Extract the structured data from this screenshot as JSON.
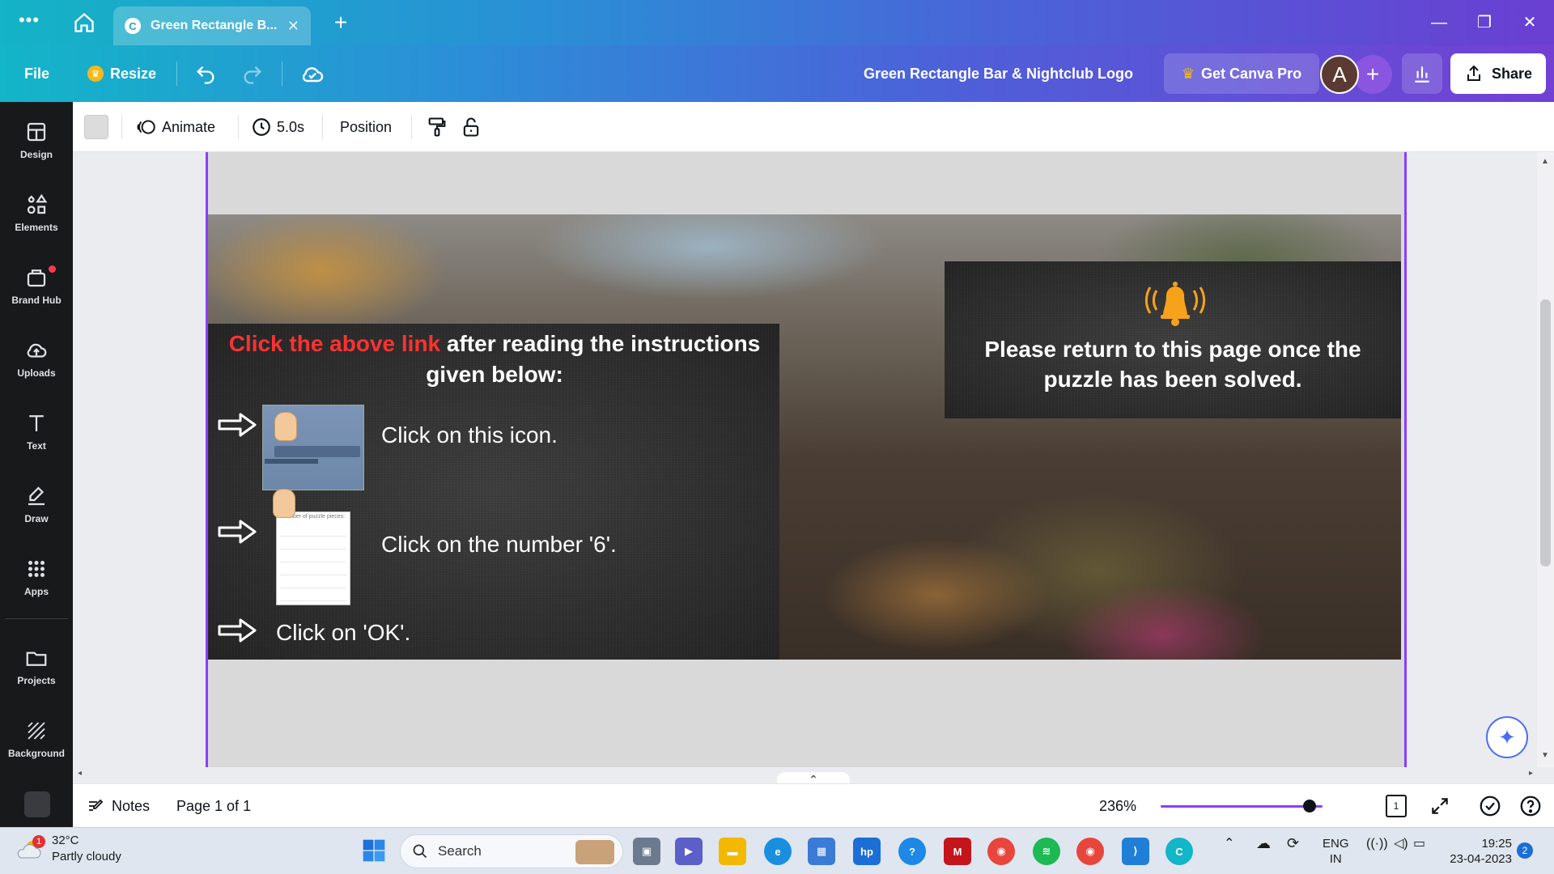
{
  "browser": {
    "tab_title": "Green Rectangle B...",
    "menu_icon": "more-dots-icon",
    "home_icon": "home-icon",
    "new_tab_icon": "plus-icon",
    "window_controls": [
      "minimize-icon",
      "restore-icon",
      "close-icon"
    ]
  },
  "header": {
    "file_label": "File",
    "resize_label": "Resize",
    "document_title": "Green Rectangle Bar & Nightclub Logo",
    "get_pro_label": "Get Canva Pro",
    "avatar_initial": "A",
    "share_label": "Share"
  },
  "sidebar": {
    "items": [
      {
        "label": "Design",
        "icon": "design-icon"
      },
      {
        "label": "Elements",
        "icon": "elements-icon"
      },
      {
        "label": "Brand Hub",
        "icon": "brand-hub-icon"
      },
      {
        "label": "Uploads",
        "icon": "upload-icon"
      },
      {
        "label": "Text",
        "icon": "text-icon"
      },
      {
        "label": "Draw",
        "icon": "draw-icon"
      },
      {
        "label": "Apps",
        "icon": "apps-icon"
      },
      {
        "label": "Projects",
        "icon": "folder-icon"
      },
      {
        "label": "Background",
        "icon": "background-icon"
      }
    ]
  },
  "toolbar": {
    "animate_label": "Animate",
    "duration_label": "5.0s",
    "position_label": "Position"
  },
  "design": {
    "left_panel": {
      "heading_red": "Click the above link",
      "heading_white": " after reading the instructions given below:",
      "thumb2_header": "mber of puzzle pieces:",
      "step1": "Click on this icon.",
      "step2": "Click on the number '6'.",
      "step3": "Click on 'OK'."
    },
    "right_panel": {
      "message": "Please return to this page once the puzzle has been solved."
    }
  },
  "footer": {
    "notes_label": "Notes",
    "page_label": "Page 1 of 1",
    "zoom_label": "236%",
    "zoom_fraction": 0.92,
    "pages_count": "1"
  },
  "taskbar": {
    "temperature": "32°C",
    "weather_desc": "Partly cloudy",
    "weather_badge": "1",
    "search_label": "Search",
    "language": "ENG",
    "region": "IN",
    "time": "19:25",
    "date": "23-04-2023",
    "notification_count": "2"
  },
  "colors": {
    "accent": "#8b3dff",
    "highlight_red": "#ff3131",
    "bell": "#f7a21b"
  }
}
